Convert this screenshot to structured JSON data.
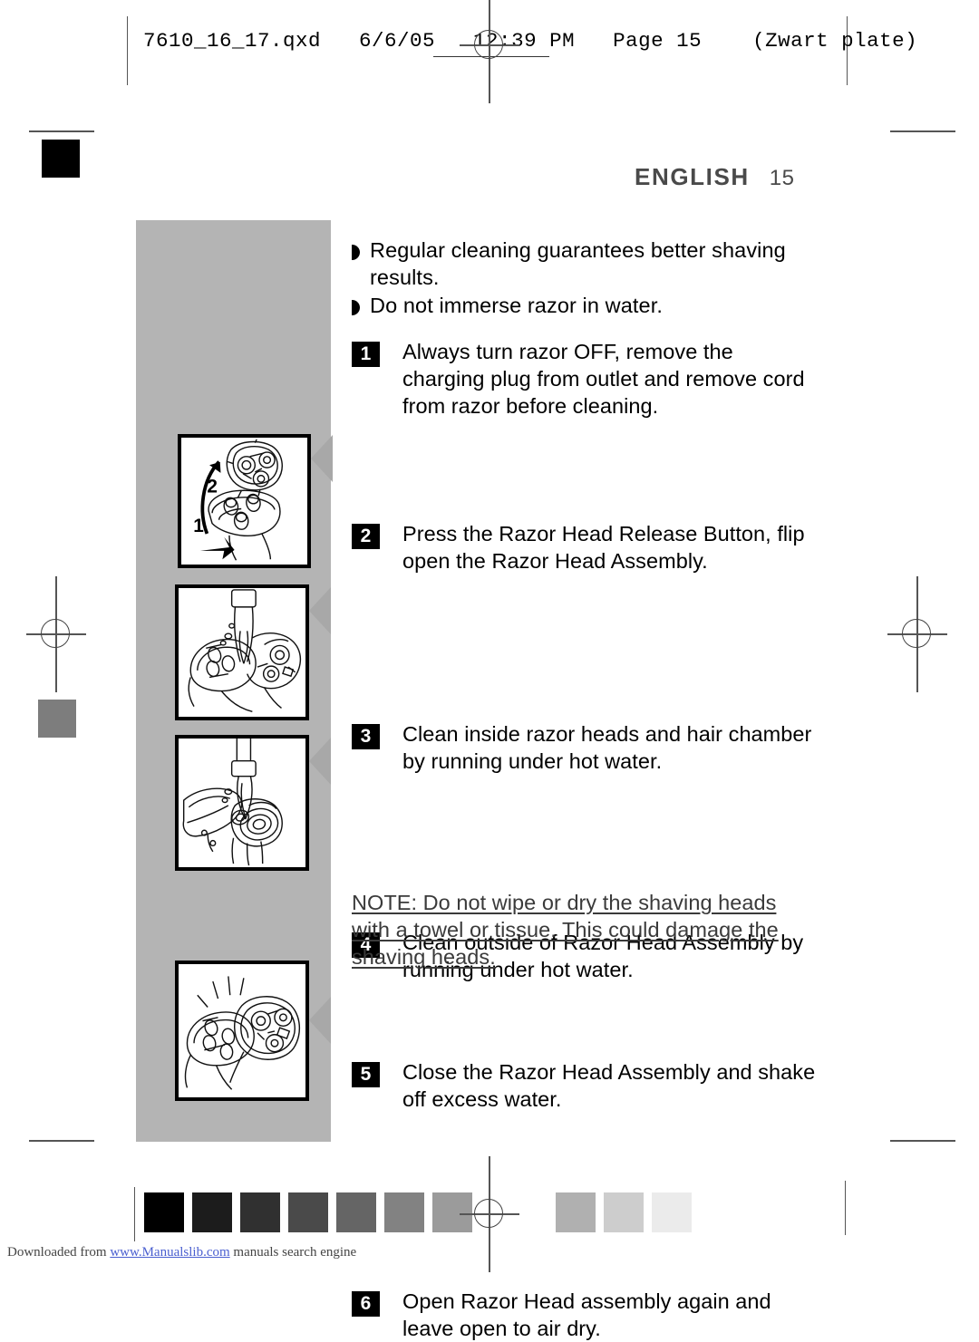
{
  "print_header": {
    "filename": "7610_16_17.qxd",
    "date": "6/6/05",
    "time": "12:39 PM",
    "page_marker": "Page 15",
    "plate": "(Zwart plate)",
    "full_line": "7610_16_17.qxd   6/6/05   12:39 PM   Page 15    (Zwart plate)"
  },
  "header": {
    "language_title": "ENGLISH",
    "page_number": "15"
  },
  "bullets": [
    {
      "icon": "half-disc-bullet",
      "text": "Regular cleaning guarantees better shaving results."
    },
    {
      "icon": "half-disc-bullet",
      "text": "Do not immerse razor in water."
    }
  ],
  "steps": [
    {
      "number": "1",
      "text": "Always turn razor OFF, remove the charging plug from outlet and remove cord from razor before cleaning."
    },
    {
      "number": "2",
      "text": "Press the Razor Head Release Button, flip open the Razor Head Assembly."
    },
    {
      "number": "3",
      "text": "Clean inside razor heads and hair chamber by running under hot water."
    },
    {
      "number": "4",
      "text": "Clean outside of Razor Head Assembly by running under hot water."
    },
    {
      "number": "5",
      "text": "Close the Razor Head Assembly and shake off excess water."
    },
    {
      "number": "6",
      "text": "Open Razor Head assembly again and leave open to air dry."
    }
  ],
  "note": {
    "lines": [
      "NOTE: Do not wipe or dry the shaving heads",
      "with a towel or tissue. This could damage the",
      "shaving heads."
    ]
  },
  "figures": [
    {
      "name": "razor-head-flip-open-illustration",
      "callouts": [
        "2",
        "1"
      ]
    },
    {
      "name": "rinse-inside-razor-heads-illustration",
      "callouts": []
    },
    {
      "name": "rinse-outside-razor-head-illustration",
      "callouts": []
    },
    {
      "name": "razor-head-open-air-dry-illustration",
      "callouts": []
    }
  ],
  "grayscale_strip": {
    "dark_swatches": [
      "#000000",
      "#1c1c1c",
      "#303030",
      "#4a4a4a",
      "#656565",
      "#828282",
      "#9b9b9b"
    ],
    "light_swatches": [
      "#b0b0b0",
      "#cdcdcd",
      "#ebebeb"
    ]
  },
  "registration": {
    "patch_black": "#000000",
    "patch_gray": "#7d7d7d",
    "mark_color": "#555555"
  },
  "footer": {
    "prefix": "Downloaded from ",
    "link": "www.Manualslib.com",
    "suffix": " manuals search engine"
  }
}
